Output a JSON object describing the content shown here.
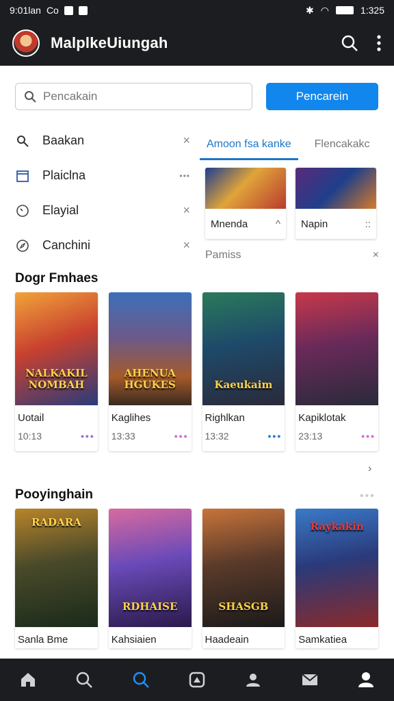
{
  "status": {
    "time": "9:01lan",
    "carrier": "Co",
    "clock": "1:325"
  },
  "app": {
    "title": "MalplkeUiungah"
  },
  "search": {
    "placeholder": "Pencakain",
    "button": "Pencarein"
  },
  "recent": [
    {
      "label": "Baakan",
      "icon": "search-icon",
      "end": "×"
    },
    {
      "label": "Plaiclna",
      "icon": "calendar-icon",
      "end": "•••"
    },
    {
      "label": "Elayial",
      "icon": "clock-icon",
      "end": "×"
    },
    {
      "label": "Canchini",
      "icon": "compass-icon",
      "end": "×"
    }
  ],
  "tabs": [
    "Amoon fsa kanke",
    "Flencakakc"
  ],
  "mini_cards": [
    {
      "name": "Mnenda",
      "end": "^"
    },
    {
      "name": "Napin",
      "end": "::"
    }
  ],
  "filter": {
    "label": "Pamiss",
    "close": "×"
  },
  "section1": {
    "title": "Dogr Fmhaes",
    "cards": [
      {
        "cover_text": "NALKAKIL NOMBAH",
        "name": "Uotail",
        "time": "10:13",
        "dots": "•••"
      },
      {
        "cover_text": "AHENUA HGUKES",
        "name": "Kaglihes",
        "time": "13:33",
        "dots": "•••"
      },
      {
        "cover_text": "Kaeukaim",
        "name": "Righlkan",
        "time": "13:32",
        "dots": "•••"
      },
      {
        "cover_text": "",
        "name": "Kapiklotak",
        "time": "23:13",
        "dots": "•••"
      }
    ]
  },
  "section2": {
    "title": "Pooyinghain",
    "cards": [
      {
        "cover_text": "RADARA",
        "name": "Sanla Bme"
      },
      {
        "cover_text": "RDHAISE",
        "name": "Kahsiaien"
      },
      {
        "cover_text": "SHASGB",
        "name": "Haadeain"
      },
      {
        "cover_text": "Raykakin",
        "name": "Samkatiea"
      }
    ]
  },
  "colors": {
    "accent": "#1186ec",
    "bar": "#1c1d20",
    "tab": "#1b77c9"
  }
}
